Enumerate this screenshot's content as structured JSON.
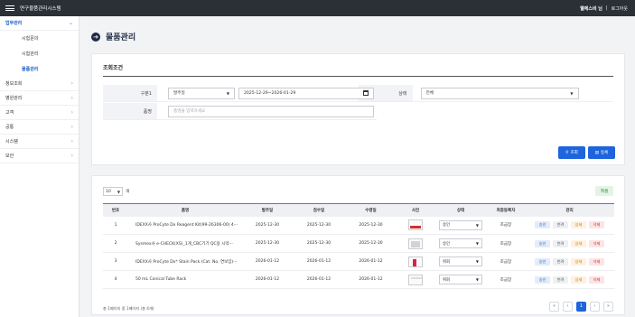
{
  "topbar": {
    "title": "연구물품관리시스템",
    "user": "웰에스비 님",
    "logout": "로그아웃"
  },
  "sidebar": {
    "items": [
      {
        "label": "업무관리",
        "active": true
      },
      {
        "label": "정보조회"
      },
      {
        "label": "병원관리"
      },
      {
        "label": "고객"
      },
      {
        "label": "공통"
      },
      {
        "label": "시스템"
      },
      {
        "label": "보안"
      }
    ],
    "subitems": [
      {
        "label": "시험문의"
      },
      {
        "label": "시험관리"
      },
      {
        "label": "물품관리",
        "active": true
      }
    ]
  },
  "page": {
    "title": "물품관리"
  },
  "search": {
    "title": "조회조건",
    "gubun_label": "구분1",
    "gubun_value": "발주일",
    "date_range": "2025-12-29~2026-01-29",
    "status_label": "상태",
    "status_value": "전체",
    "name_label": "품명",
    "name_placeholder": "품명을 입력하세요",
    "search_button": "조회",
    "register_button": "등록"
  },
  "list": {
    "page_size": "10",
    "page_size_unit": "개",
    "excel_button": "엑셀",
    "columns": [
      "번호",
      "품명",
      "발주일",
      "검수일",
      "수령일",
      "사진",
      "상태",
      "최종등록자",
      "관리"
    ],
    "rows": [
      {
        "no": "1",
        "name": "IDEXX사 ProCyte Dx Reagent Kit(99-26306-00) 4···",
        "order_date": "2025-12-30",
        "inspect_date": "2025-12-30",
        "receive_date": "2025-12-30",
        "status": "승인",
        "registrant": "조금장"
      },
      {
        "no": "2",
        "name": "Sysmex사 e-CHECK(XS)_1개_CBC기기 QC용 시약···",
        "order_date": "2025-12-30",
        "inspect_date": "2025-12-30",
        "receive_date": "2025-12-30",
        "status": "승인",
        "registrant": "조금장"
      },
      {
        "no": "3",
        "name": "IDEXX사 ProCyte Dx* Stain Pack (Cat. No. 연보임)···",
        "order_date": "2026-01-12",
        "inspect_date": "2026-01-12",
        "receive_date": "2026-01-12",
        "status": "위회",
        "registrant": "조금장"
      },
      {
        "no": "4",
        "name": "50 mL Conical Tube Rack",
        "order_date": "2026-01-12",
        "inspect_date": "2026-01-12",
        "receive_date": "2026-01-12",
        "status": "위회",
        "registrant": "조금장"
      }
    ],
    "actions": {
      "approve": "승인",
      "reject": "반려",
      "detail": "상세",
      "delete": "삭제"
    },
    "summary": "총 1페이지 중 1페이지 (총 4개)",
    "pagination": {
      "first": "«",
      "prev": "‹",
      "current": "1",
      "next": "›",
      "last": "»"
    }
  }
}
